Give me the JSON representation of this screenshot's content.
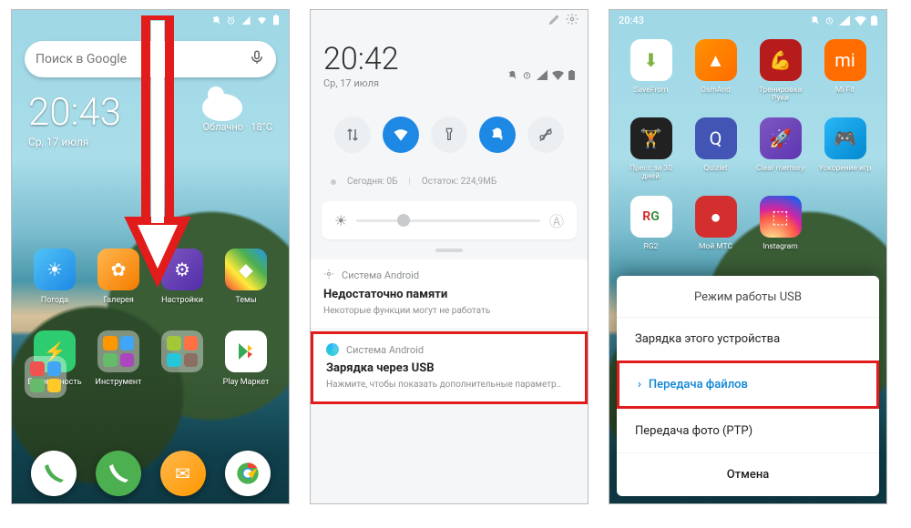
{
  "status": {
    "time_left": "",
    "time_s3": "20:43"
  },
  "screen1": {
    "search_placeholder": "Поиск в Google",
    "clock": "20:43",
    "date": "Ср, 17 июля",
    "weather_text": "Облачно · 18°C",
    "apps_row1": [
      "Погода",
      "Галерея",
      "Настройки",
      "Темы"
    ],
    "apps_row2": [
      "Безопасность",
      "Инструмент",
      "",
      "Play Маркет"
    ],
    "dock": [
      "phone",
      "messages",
      "browser",
      "camera"
    ]
  },
  "screen2": {
    "clock": "20:42",
    "date": "Ср, 17 июля",
    "storage_today": "Сегодня: 0Б",
    "storage_remain": "Остаток: 224,9МБ",
    "toggles": [
      "data",
      "wifi",
      "torch",
      "dnd",
      "scissors"
    ],
    "notif1": {
      "app": "Система Android",
      "title": "Недостаточно памяти",
      "body": "Некоторые функции могут не работать"
    },
    "notif2": {
      "app": "Система Android",
      "title": "Зарядка через USB",
      "body": "Нажмите, чтобы показать дополнительные параметр.."
    }
  },
  "screen3": {
    "apps_r1": [
      "SaveFrom",
      "OsmAnd",
      "Тренировка Руки",
      "Mi Fit"
    ],
    "apps_r2": [
      "Пресс за 30 дней",
      "Quizlet",
      "Clear memory",
      "Ускорение игр"
    ],
    "apps_r3": [
      "RG2",
      "Мой МТС",
      "Instagram",
      ""
    ],
    "sheet_title": "Режим работы USB",
    "opt1": "Зарядка этого устройства",
    "opt2": "Передача файлов",
    "opt3": "Передача фото (PTP)",
    "cancel": "Отмена"
  }
}
